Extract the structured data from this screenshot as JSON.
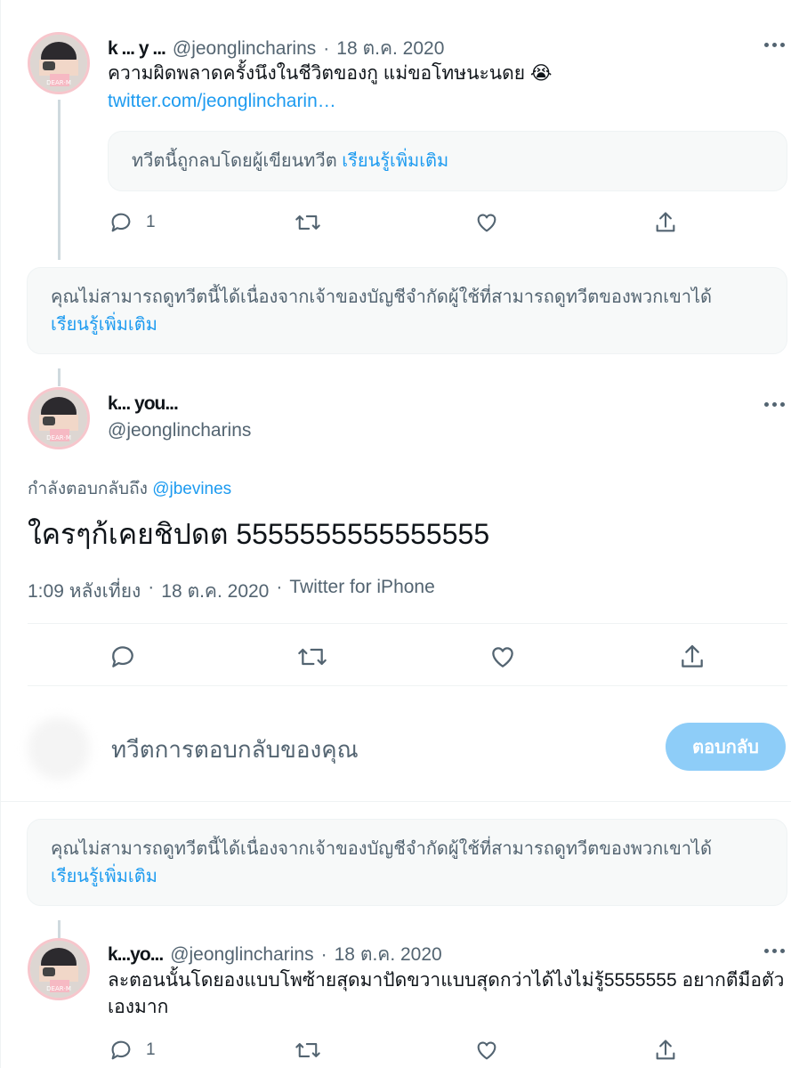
{
  "tweet1": {
    "name": "k ... y ...",
    "handle": "@jeonglincharins",
    "separator": "·",
    "date": "18 ต.ค. 2020",
    "text": "ความผิดพลาดครั้งนึงในชีวิตของกู แม่ขอโทษนะนดย 😭",
    "link": "twitter.com/jeonglincharin…",
    "quote_notice": "ทวีตนี้ถูกลบโดยผู้เขียนทวีต",
    "quote_learn_more": "เรียนรู้เพิ่มเติม",
    "reply_count": "1",
    "avatar_text": "DEAR·M",
    "icons": [
      "reply-icon",
      "retweet-icon",
      "like-icon",
      "share-icon",
      "more-icon"
    ]
  },
  "notice1": {
    "text": "คุณไม่สามารถดูทวีตนี้ได้เนื่องจากเจ้าของบัญชีจำกัดผู้ใช้ที่สามารถดูทวีตของพวกเขาได้",
    "learn_more": "เรียนรู้เพิ่มเติม"
  },
  "main_tweet": {
    "name": "k... you...",
    "handle": "@jeonglincharins",
    "replying_label": "กำลังตอบกลับถึง",
    "replying_to": "@jbevines",
    "text": "ใครๆก้เคยชิปดต 5555555555555555",
    "time": "1:09 หลังเที่ยง",
    "separator": "·",
    "date": "18 ต.ค. 2020",
    "source": "Twitter for iPhone",
    "avatar_text": "DEAR·M"
  },
  "composer": {
    "placeholder": "ทวีตการตอบกลับของคุณ",
    "button": "ตอบกลับ"
  },
  "notice2": {
    "text": "คุณไม่สามารถดูทวีตนี้ได้เนื่องจากเจ้าของบัญชีจำกัดผู้ใช้ที่สามารถดูทวีตของพวกเขาได้",
    "learn_more": "เรียนรู้เพิ่มเติม"
  },
  "tweet3": {
    "name": "k...yo...",
    "handle": "@jeonglincharins",
    "separator": "·",
    "date": "18 ต.ค. 2020",
    "text": "ละตอนนั้นโดยองแบบโพซ้ายสุดมาปัดขวาแบบสุดกว่าได้ไงไม่รู้5555555 อยากตีมือตัวเองมาก",
    "reply_count": "1",
    "avatar_text": "DEAR·M"
  },
  "colors": {
    "accent": "#1d9bf0",
    "muted": "#536471",
    "button_disabled": "#8ecdf8",
    "avatar_border": "#f7c6cc"
  }
}
